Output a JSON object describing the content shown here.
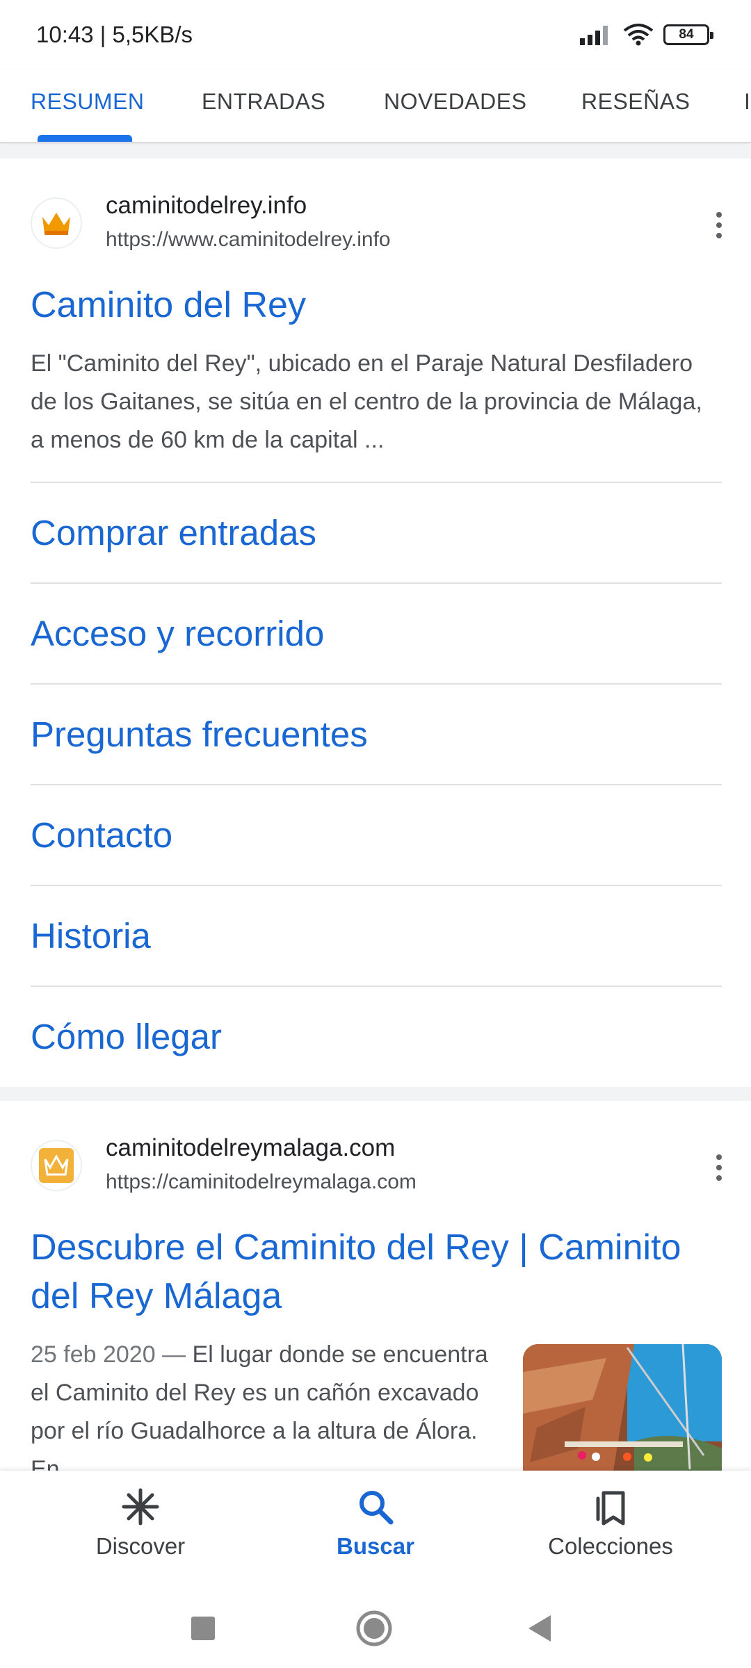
{
  "status_bar": {
    "time": "10:43 | 5,5KB/s",
    "battery": "84",
    "icons": [
      "signal-icon",
      "wifi-icon",
      "battery-icon"
    ]
  },
  "tabs": [
    {
      "label": "RESUMEN",
      "active": true
    },
    {
      "label": "ENTRADAS",
      "active": false
    },
    {
      "label": "NOVEDADES",
      "active": false
    },
    {
      "label": "RESEÑAS",
      "active": false
    },
    {
      "label": "I",
      "active": false
    }
  ],
  "results": [
    {
      "site_name": "caminitodelrey.info",
      "url": "https://www.caminitodelrey.info",
      "title": "Caminito del Rey",
      "snippet": "El \"Caminito del Rey\", ubicado en el Paraje Natural Desfiladero de los Gaitanes, se sitúa en el centro de la provincia de Málaga, a menos de 60 km de la capital ...",
      "sitelinks": [
        "Comprar entradas",
        "Acceso y recorrido",
        "Preguntas frecuentes",
        "Contacto",
        "Historia",
        "Cómo llegar"
      ]
    },
    {
      "site_name": "caminitodelreymalaga.com",
      "url": "https://caminitodelreymalaga.com",
      "title": "Descubre el Caminito del Rey | Caminito del Rey Málaga",
      "date": "25 feb 2020 —",
      "snippet": "El lugar donde se encuentra el Caminito del Rey es un cañón excavado por el río Guadalhorce a la altura de Álora. En"
    }
  ],
  "bottom_nav": [
    {
      "label": "Discover",
      "icon": "asterisk-icon",
      "active": false
    },
    {
      "label": "Buscar",
      "icon": "search-icon",
      "active": true
    },
    {
      "label": "Colecciones",
      "icon": "bookmarks-icon",
      "active": false
    }
  ],
  "colors": {
    "accent": "#1a73e8",
    "link": "#1967d2",
    "divider": "#e0e0e0",
    "band": "#f1f3f4"
  }
}
